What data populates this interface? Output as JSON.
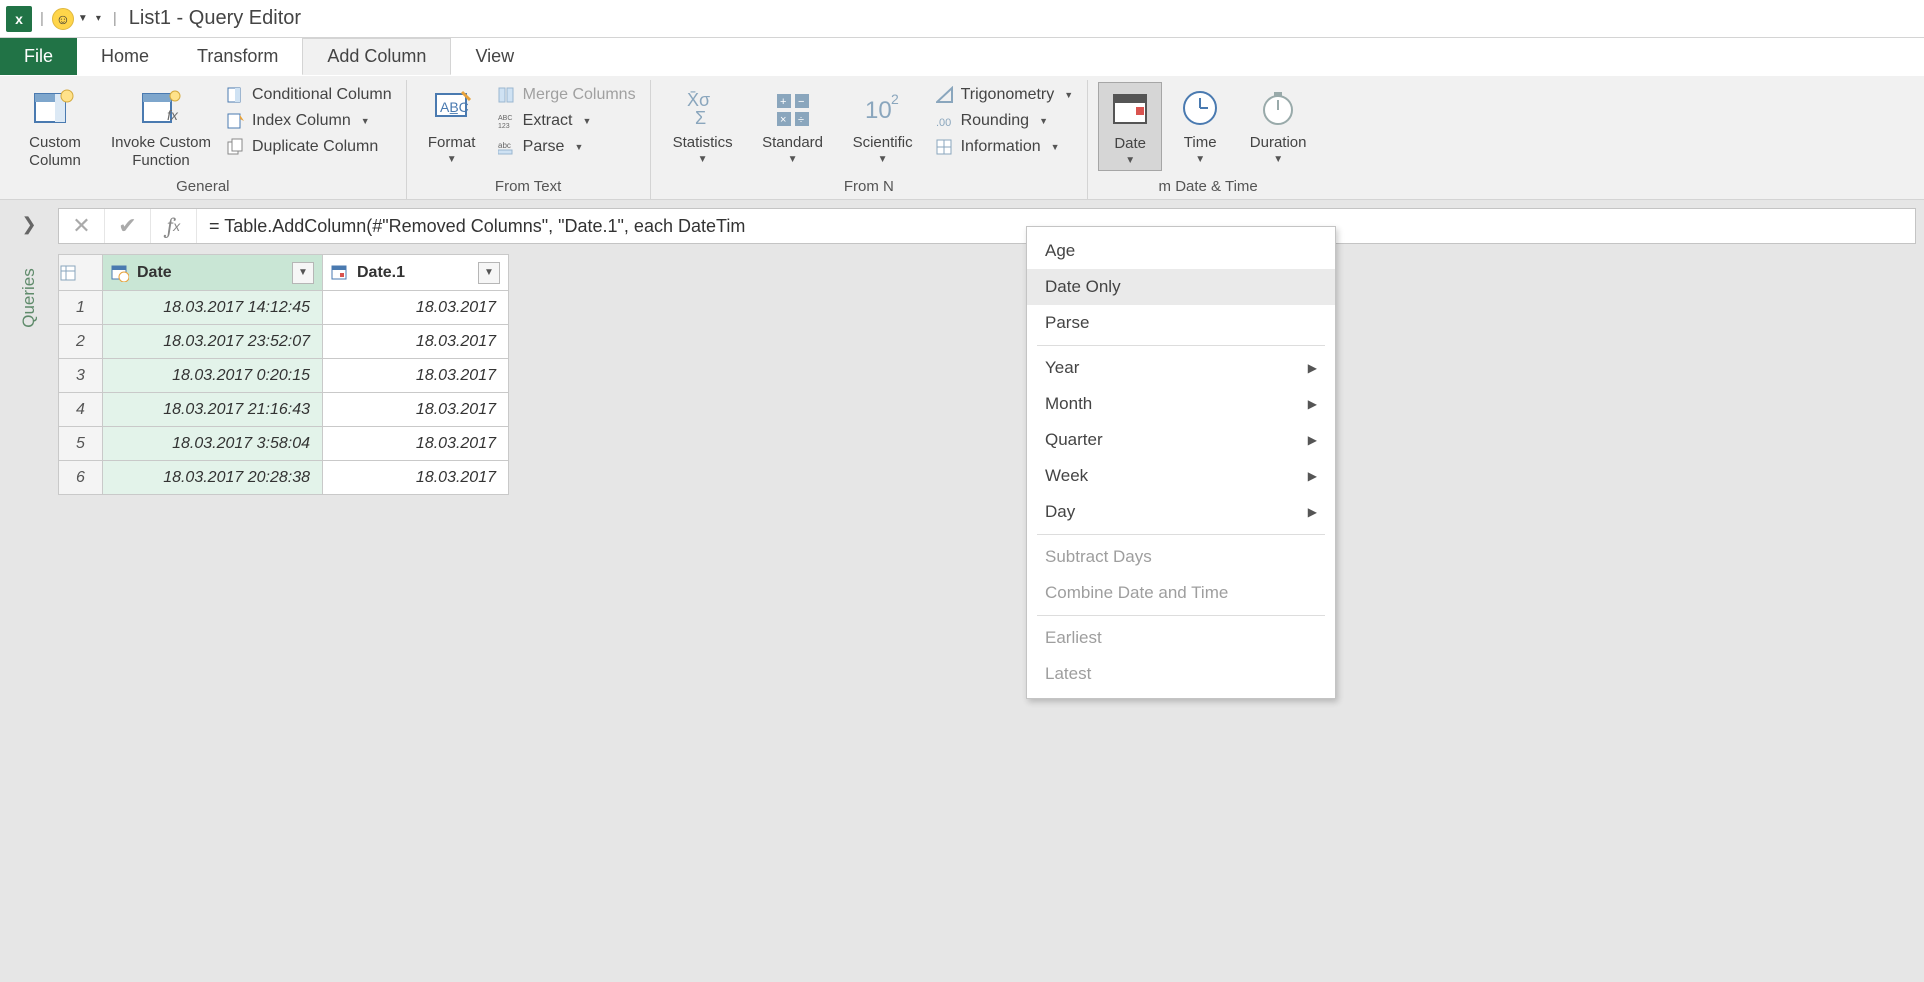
{
  "titlebar": {
    "title": "List1 - Query Editor"
  },
  "tabs": {
    "file": "File",
    "items": [
      "Home",
      "Transform",
      "Add Column",
      "View"
    ],
    "active": "Add Column"
  },
  "ribbon": {
    "groups": {
      "general": {
        "label": "General",
        "custom_column": "Custom Column",
        "invoke_custom_function": "Invoke Custom Function",
        "conditional_column": "Conditional Column",
        "index_column": "Index Column",
        "duplicate_column": "Duplicate Column"
      },
      "from_text": {
        "label": "From Text",
        "format": "Format",
        "merge_columns": "Merge Columns",
        "extract": "Extract",
        "parse": "Parse"
      },
      "from_number": {
        "label": "From N",
        "statistics": "Statistics",
        "standard": "Standard",
        "scientific": "Scientific",
        "trigonometry": "Trigonometry",
        "rounding": "Rounding",
        "information": "Information"
      },
      "from_datetime": {
        "label": "m Date & Time",
        "date": "Date",
        "time": "Time",
        "duration": "Duration"
      }
    }
  },
  "date_menu": {
    "items": [
      {
        "label": "Age",
        "enabled": true,
        "submenu": false
      },
      {
        "label": "Date Only",
        "enabled": true,
        "submenu": false,
        "hovered": true
      },
      {
        "label": "Parse",
        "enabled": true,
        "submenu": false
      },
      {
        "divider": true
      },
      {
        "label": "Year",
        "enabled": true,
        "submenu": true
      },
      {
        "label": "Month",
        "enabled": true,
        "submenu": true
      },
      {
        "label": "Quarter",
        "enabled": true,
        "submenu": true
      },
      {
        "label": "Week",
        "enabled": true,
        "submenu": true
      },
      {
        "label": "Day",
        "enabled": true,
        "submenu": true
      },
      {
        "divider": true
      },
      {
        "label": "Subtract Days",
        "enabled": false,
        "submenu": false
      },
      {
        "label": "Combine Date and Time",
        "enabled": false,
        "submenu": false
      },
      {
        "divider": true
      },
      {
        "label": "Earliest",
        "enabled": false,
        "submenu": false
      },
      {
        "label": "Latest",
        "enabled": false,
        "submenu": false
      }
    ]
  },
  "formula": "= Table.AddColumn(#\"Removed Columns\", \"Date.1\", each DateTim",
  "sidebar": {
    "label": "Queries"
  },
  "table": {
    "columns": [
      {
        "name": "Date",
        "selected": true,
        "type": "datetime"
      },
      {
        "name": "Date.1",
        "selected": false,
        "type": "date"
      }
    ],
    "rows": [
      {
        "n": "1",
        "Date": "18.03.2017 14:12:45",
        "Date1": "18.03.2017"
      },
      {
        "n": "2",
        "Date": "18.03.2017 23:52:07",
        "Date1": "18.03.2017"
      },
      {
        "n": "3",
        "Date": "18.03.2017 0:20:15",
        "Date1": "18.03.2017"
      },
      {
        "n": "4",
        "Date": "18.03.2017 21:16:43",
        "Date1": "18.03.2017"
      },
      {
        "n": "5",
        "Date": "18.03.2017 3:58:04",
        "Date1": "18.03.2017"
      },
      {
        "n": "6",
        "Date": "18.03.2017 20:28:38",
        "Date1": "18.03.2017"
      }
    ]
  }
}
